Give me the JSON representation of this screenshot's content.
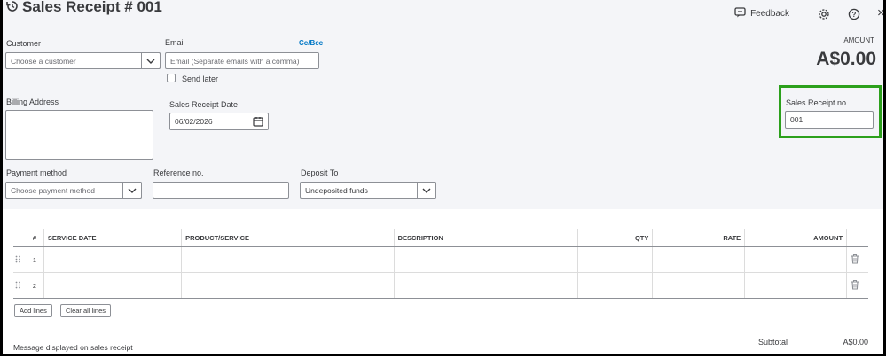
{
  "header": {
    "title": "Sales Receipt # 001",
    "feedback_label": "Feedback",
    "close_glyph": "×"
  },
  "customer": {
    "label": "Customer",
    "placeholder": "Choose a customer"
  },
  "email": {
    "label": "Email",
    "cc_bcc": "Cc/Bcc",
    "placeholder": "Email (Separate emails with a comma)",
    "send_later": "Send later"
  },
  "amount": {
    "label": "AMOUNT",
    "value": "A$0.00"
  },
  "billing": {
    "label": "Billing Address"
  },
  "receipt_date": {
    "label": "Sales Receipt Date",
    "value": "06/02/2026"
  },
  "receipt_no": {
    "label": "Sales Receipt no.",
    "value": "001"
  },
  "payment": {
    "label": "Payment method",
    "placeholder": "Choose payment method"
  },
  "reference": {
    "label": "Reference no."
  },
  "deposit": {
    "label": "Deposit To",
    "value": "Undeposited funds"
  },
  "table": {
    "columns": [
      "#",
      "SERVICE DATE",
      "PRODUCT/SERVICE",
      "DESCRIPTION",
      "QTY",
      "RATE",
      "AMOUNT"
    ],
    "rows": [
      {
        "index": "1"
      },
      {
        "index": "2"
      }
    ]
  },
  "actions": {
    "add_lines": "Add lines",
    "clear_all_lines": "Clear all lines"
  },
  "footer": {
    "message_label": "Message displayed on sales receipt",
    "subtotal_label": "Subtotal",
    "subtotal_value": "A$0.00"
  },
  "colors": {
    "highlight": "#2ca01c",
    "link": "#0077c5",
    "header_bg": "#f4f5f8"
  },
  "icons": [
    "history-icon",
    "feedback-icon",
    "gear-icon",
    "help-icon",
    "close-icon",
    "chevron-down-icon",
    "calendar-icon",
    "drag-handle-icon",
    "trash-icon"
  ]
}
